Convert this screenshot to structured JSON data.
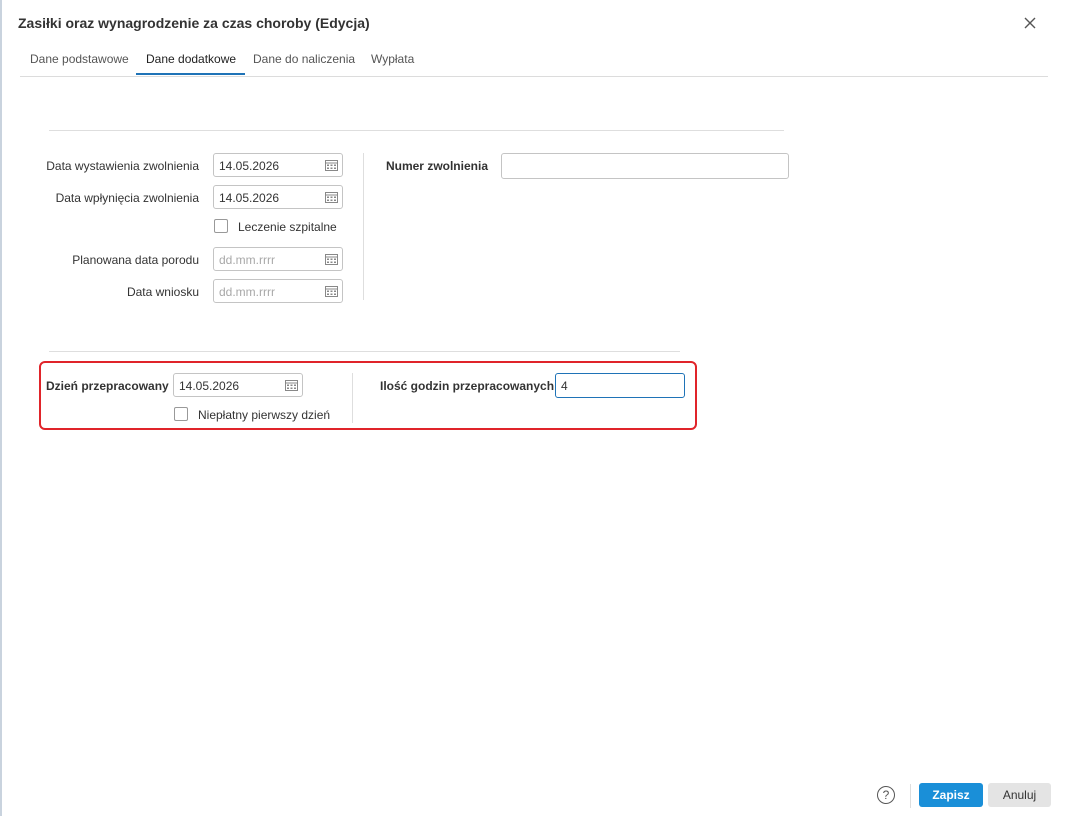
{
  "dialog": {
    "title": "Zasiłki oraz wynagrodzenie za czas choroby (Edycja)"
  },
  "tabs": [
    {
      "label": "Dane podstawowe"
    },
    {
      "label": "Dane dodatkowe",
      "active": true
    },
    {
      "label": "Dane do naliczenia"
    },
    {
      "label": "Wypłata"
    }
  ],
  "form": {
    "issue_date": {
      "label": "Data wystawienia zwolnienia",
      "value": "14.05.2026"
    },
    "receipt_date": {
      "label": "Data wpłynięcia zwolnienia",
      "value": "14.05.2026"
    },
    "hospital": {
      "label": "Leczenie szpitalne",
      "checked": false
    },
    "birth_date": {
      "label": "Planowana data porodu",
      "placeholder": "dd.mm.rrrr"
    },
    "request_date": {
      "label": "Data wniosku",
      "placeholder": "dd.mm.rrrr"
    },
    "leave_number": {
      "label": "Numer zwolnienia",
      "value": ""
    }
  },
  "worked": {
    "day": {
      "label": "Dzień przepracowany",
      "value": "14.05.2026"
    },
    "unpaid_first_day": {
      "label": "Niepłatny pierwszy dzień",
      "checked": false
    },
    "hours": {
      "label": "Ilość godzin przepracowanych",
      "value": "4"
    }
  },
  "footer": {
    "help": "?",
    "save": "Zapisz",
    "cancel": "Anuluj"
  },
  "colors": {
    "accent": "#1a8fd8",
    "highlight": "#e0242a",
    "tab_underline": "#1f73b7"
  },
  "icons": {
    "close": "close-icon",
    "calendar": "calendar-icon",
    "help": "help-icon"
  }
}
